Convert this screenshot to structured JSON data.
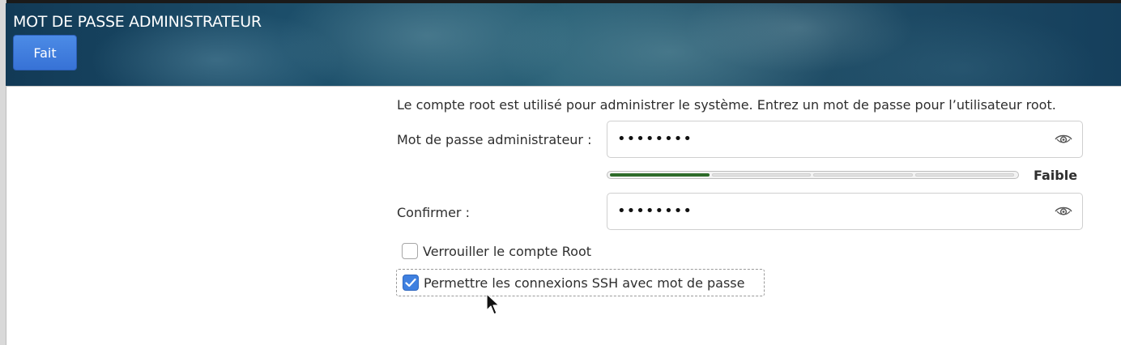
{
  "header": {
    "title": "MOT DE PASSE ADMINISTRATEUR",
    "done_label": "Fait"
  },
  "form": {
    "description": "Le compte root est utilisé pour administrer le système. Entrez un mot de passe pour l’utilisateur root.",
    "password_label": "Mot de passe administrateur :",
    "password_value": "••••••••",
    "confirm_label": "Confirmer :",
    "confirm_value": "••••••••",
    "strength": {
      "label": "Faible",
      "level": 1,
      "max": 4
    },
    "lock_root": {
      "label": "Verrouiller le compte Root",
      "checked": false
    },
    "allow_ssh": {
      "label": "Permettre les connexions SSH avec mot de passe",
      "checked": true
    }
  },
  "icons": {
    "reveal_password": "eye-icon",
    "check": "checkmark-icon",
    "pointer": "mouse-pointer-icon"
  },
  "colors": {
    "accent": "#3f80e0",
    "strength_weak": "#2e6b2a",
    "header_dark": "#123a56"
  }
}
